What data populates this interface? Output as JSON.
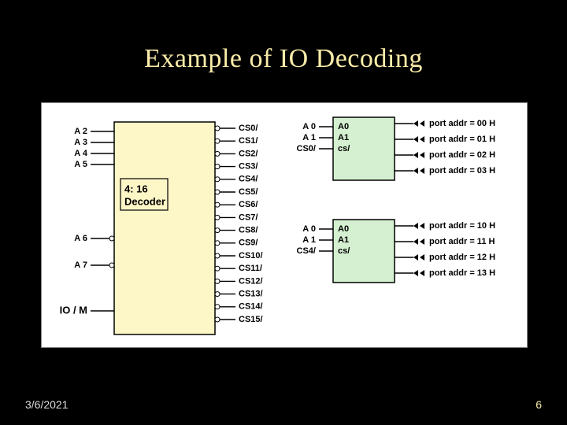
{
  "title": "Example of IO Decoding",
  "footer": {
    "date": "3/6/2021",
    "page": "6"
  },
  "decoder": {
    "label": "4: 16\nDecoder",
    "left_inputs_top": [
      "A 2",
      "A 3",
      "A 4",
      "A 5"
    ],
    "left_inputs_mid": [
      "A 6",
      "A 7"
    ],
    "left_input_bottom": "IO / M",
    "outputs": [
      "CS0/",
      "CS1/",
      "CS2/",
      "CS3/",
      "CS4/",
      "CS5/",
      "CS6/",
      "CS7/",
      "CS8/",
      "CS9/",
      "CS10/",
      "CS11/",
      "CS12/",
      "CS13/",
      "CS14/",
      "CS15/"
    ]
  },
  "chips": [
    {
      "left_labels": [
        "A 0",
        "A 1",
        "CS0/"
      ],
      "pins": [
        "A0",
        "A1",
        "cs/"
      ],
      "ports": [
        "port addr = 00 H",
        "port addr = 01 H",
        "port addr = 02 H",
        "port addr = 03 H"
      ]
    },
    {
      "left_labels": [
        "A 0",
        "A 1",
        "CS4/"
      ],
      "pins": [
        "A0",
        "A1",
        "cs/"
      ],
      "ports": [
        "port addr = 10 H",
        "port addr = 11 H",
        "port addr = 12 H",
        "port addr = 13 H"
      ]
    }
  ]
}
